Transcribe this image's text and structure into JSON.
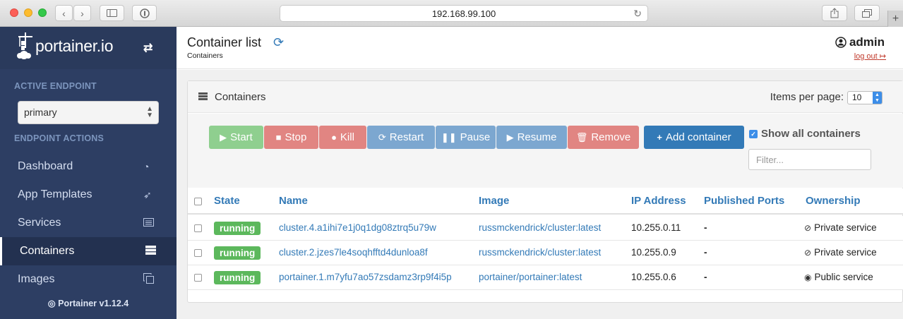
{
  "browser": {
    "url": "192.168.99.100",
    "new_tab": "+"
  },
  "sidebar": {
    "brand": "portainer.io",
    "active_endpoint_header": "ACTIVE ENDPOINT",
    "endpoint_value": "primary",
    "endpoint_actions_header": "ENDPOINT ACTIONS",
    "items": [
      {
        "label": "Dashboard",
        "icon": "tachometer-icon"
      },
      {
        "label": "App Templates",
        "icon": "rocket-icon"
      },
      {
        "label": "Services",
        "icon": "list-alt-icon"
      },
      {
        "label": "Containers",
        "icon": "server-icon",
        "active": true
      },
      {
        "label": "Images",
        "icon": "clone-icon"
      }
    ],
    "version": "Portainer v1.12.4"
  },
  "header": {
    "title": "Container list",
    "breadcrumb": "Containers",
    "user": "admin",
    "logout": "log out"
  },
  "panel": {
    "title": "Containers",
    "items_per_page_label": "Items per page:",
    "items_per_page_value": "10",
    "show_all_label": "Show all containers",
    "filter_placeholder": "Filter..."
  },
  "actions": {
    "start": "Start",
    "stop": "Stop",
    "kill": "Kill",
    "restart": "Restart",
    "pause": "Pause",
    "resume": "Resume",
    "remove": "Remove",
    "add": "Add container"
  },
  "table": {
    "columns": [
      "State",
      "Name",
      "Image",
      "IP Address",
      "Published Ports",
      "Ownership"
    ],
    "rows": [
      {
        "state": "running",
        "name": "cluster.4.a1ihi7e1j0q1dg08ztrq5u79w",
        "image": "russmckendrick/cluster:latest",
        "ip": "10.255.0.11",
        "ports": "-",
        "ownership": "Private service",
        "ownership_icon": "eye-slash-icon"
      },
      {
        "state": "running",
        "name": "cluster.2.jzes7le4soqhfftd4dunloa8f",
        "image": "russmckendrick/cluster:latest",
        "ip": "10.255.0.9",
        "ports": "-",
        "ownership": "Private service",
        "ownership_icon": "eye-slash-icon"
      },
      {
        "state": "running",
        "name": "portainer.1.m7yfu7ao57zsdamz3rp9f4i5p",
        "image": "portainer/portainer:latest",
        "ip": "10.255.0.6",
        "ports": "-",
        "ownership": "Public service",
        "ownership_icon": "eye-icon"
      }
    ]
  },
  "colors": {
    "sidebar_bg": "#2d3e63",
    "link": "#337ab7",
    "running": "#5cb85c",
    "danger": "#e18582",
    "success": "#8fcf8f",
    "primary": "#337ab7"
  }
}
